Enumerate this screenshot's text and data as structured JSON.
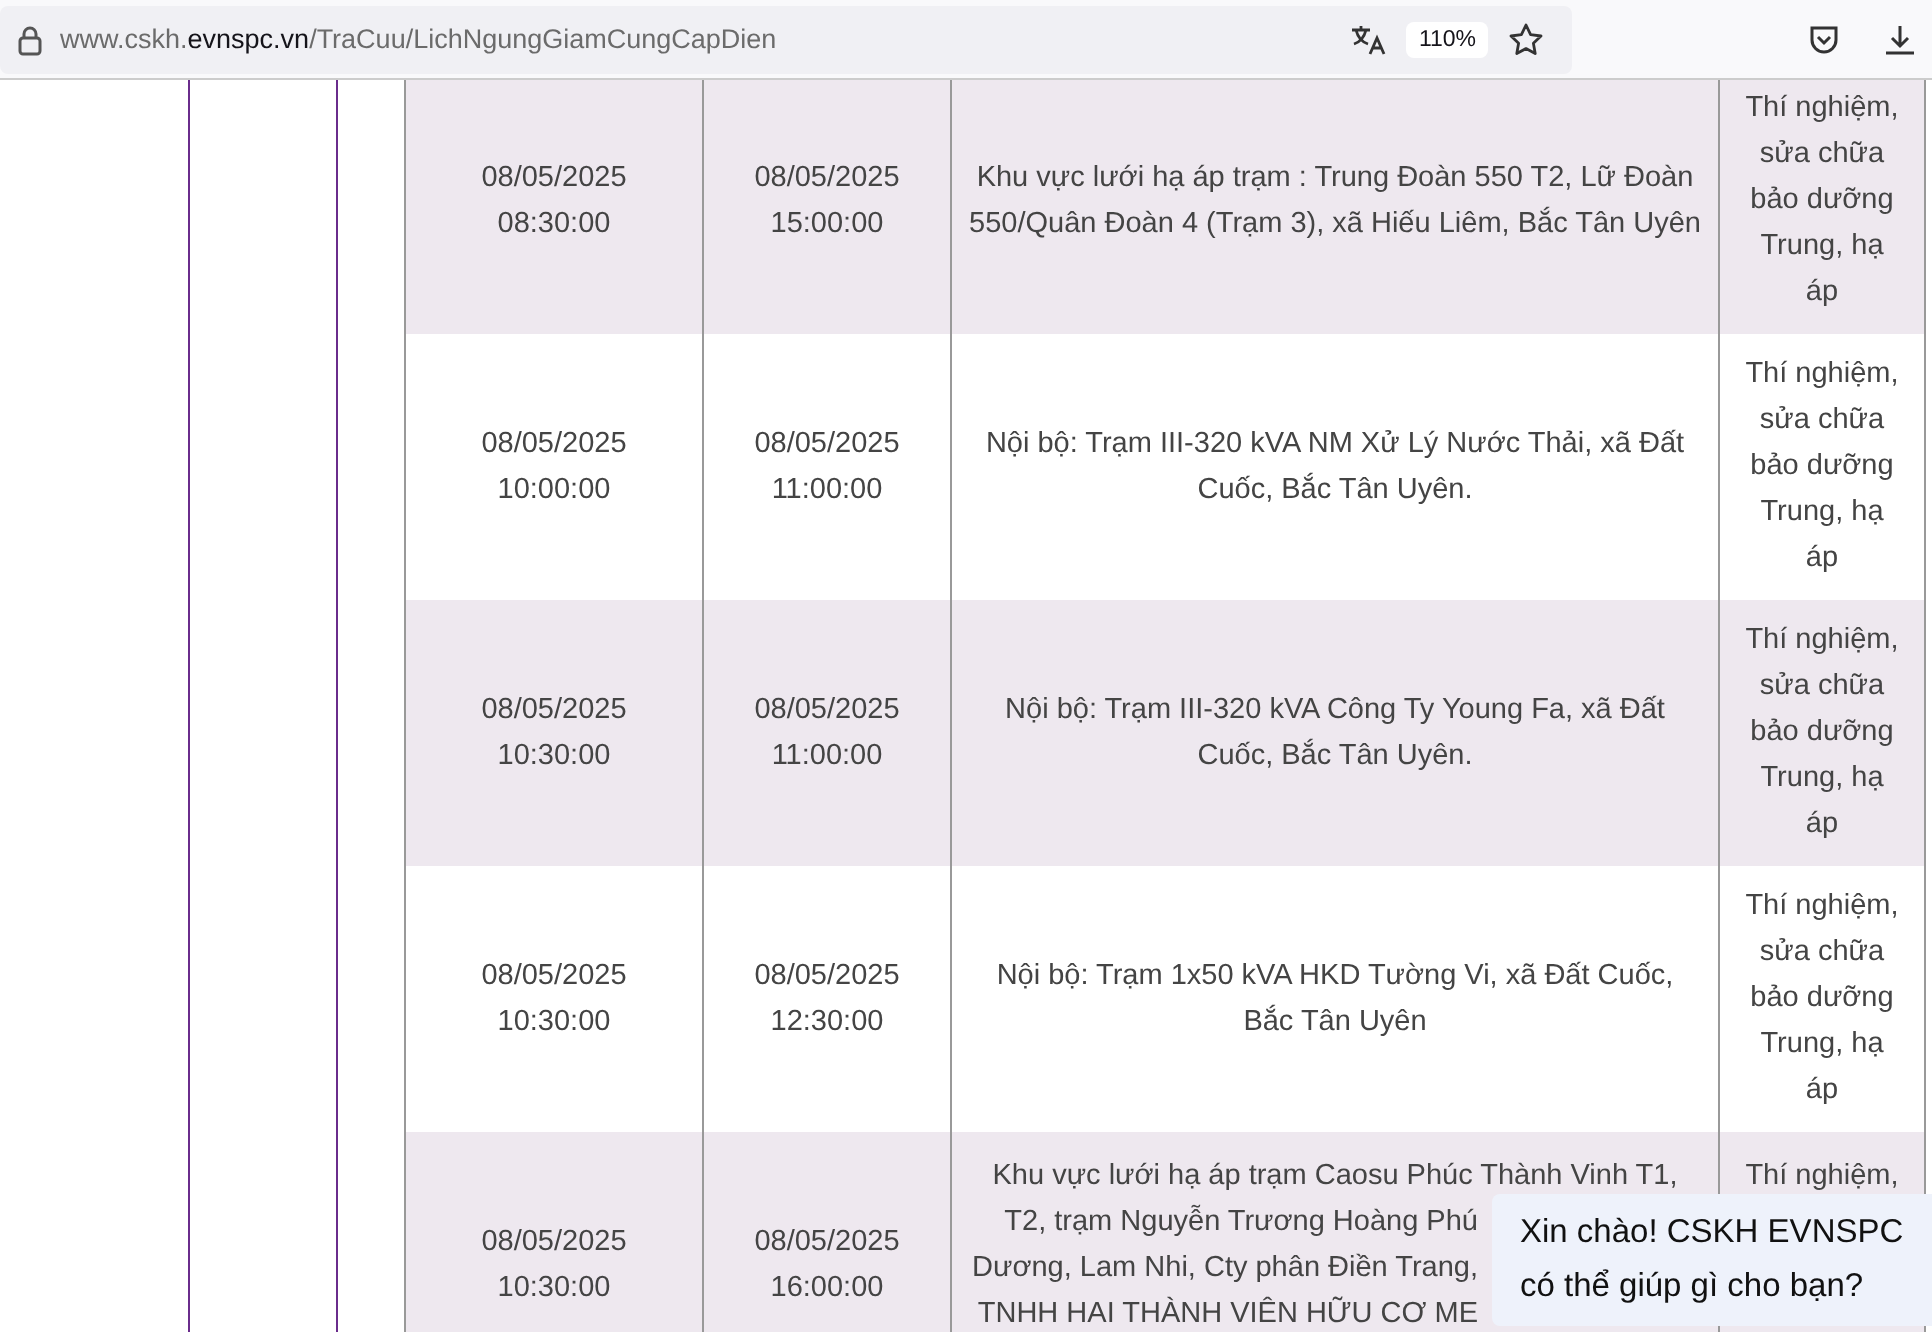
{
  "browser": {
    "url": {
      "prefix": "www.cskh.",
      "domain": "evnspc.vn",
      "path": "/TraCuu/LichNgungGiamCungCapDien"
    },
    "zoom": "110%"
  },
  "table": {
    "rows": [
      {
        "start": "08/05/2025 08:30:00",
        "end": "08/05/2025 15:00:00",
        "area": "Khu vực lưới hạ áp trạm : Trung Đoàn 550 T2, Lữ Đoàn 550/Quân Đoàn 4 (Trạm 3), xã Hiếu Liêm, Bắc Tân Uyên",
        "reason": "Thí nghiệm, sửa chữa bảo dưỡng Trung, hạ áp"
      },
      {
        "start": "08/05/2025 10:00:00",
        "end": "08/05/2025 11:00:00",
        "area": "Nội bộ: Trạm III-320 kVA NM Xử Lý Nước Thải, xã Đất Cuốc, Bắc Tân Uyên.",
        "reason": "Thí nghiệm, sửa chữa bảo dưỡng Trung, hạ áp"
      },
      {
        "start": "08/05/2025 10:30:00",
        "end": "08/05/2025 11:00:00",
        "area": "Nội bộ: Trạm III-320 kVA Công Ty Young Fa, xã Đất Cuốc, Bắc Tân Uyên.",
        "reason": "Thí nghiệm, sửa chữa bảo dưỡng Trung, hạ áp"
      },
      {
        "start": "08/05/2025 10:30:00",
        "end": "08/05/2025 12:30:00",
        "area": "Nội bộ: Trạm 1x50 kVA HKD Tường Vi, xã Đất Cuốc, Bắc Tân Uyên",
        "reason": "Thí nghiệm, sửa chữa bảo dưỡng Trung, hạ áp"
      },
      {
        "start": "08/05/2025 10:30:00",
        "end": "08/05/2025 16:00:00",
        "area_lines": [
          "Khu vực lưới hạ áp trạm Caosu Phúc Thành Vinh T1,",
          "T2, trạm Nguyễn Trương Hoàng Phú",
          "Dương, Lam Nhi, Cty phân Điền Trang,",
          "TNHH HAI THÀNH VIÊN HỮU CƠ ME"
        ],
        "reason": "Thí nghiệm,"
      }
    ]
  },
  "chat_popup": {
    "text": "Xin chào! CSKH EVNSPC có thể giúp gì cho bạn?"
  }
}
